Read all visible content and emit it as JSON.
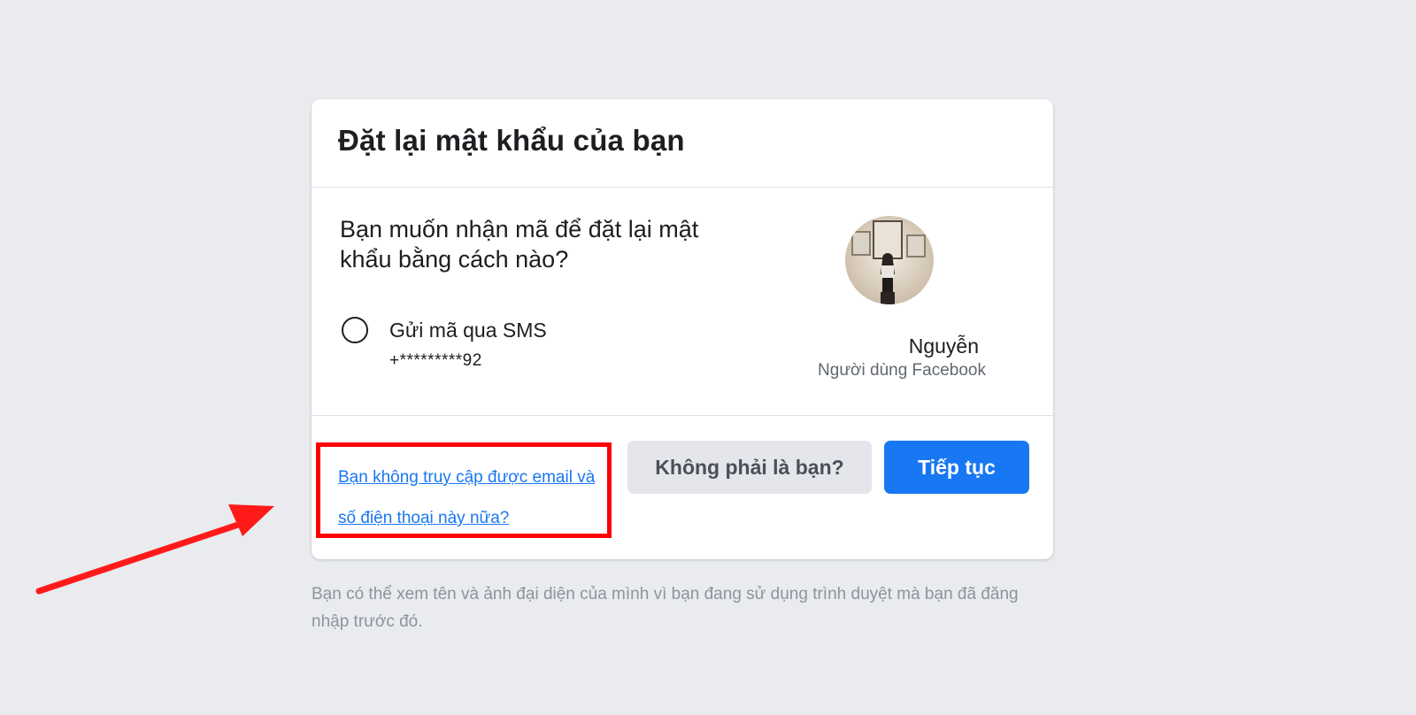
{
  "card": {
    "title": "Đặt lại mật khẩu của bạn",
    "question": "Bạn muốn nhận mã để đặt lại mật khẩu bằng cách nào?",
    "option": {
      "label": "Gửi mã qua SMS",
      "phone": "+*********92",
      "selected": false
    },
    "user": {
      "name": "Nguyễn",
      "role": "Người dùng Facebook"
    },
    "footer": {
      "help_link": "Bạn không truy cập được email và số điện thoại này nữa?",
      "not_you_label": "Không phải là bạn?",
      "continue_label": "Tiếp tục"
    }
  },
  "footnote": "Bạn có thể xem tên và ảnh đại diện của mình vì bạn đang sử dụng trình duyệt mà bạn đã đăng nhập trước đó.",
  "colors": {
    "background": "#e9ebee",
    "primary": "#1877f2",
    "secondary_button": "#e4e6eb",
    "highlight": "#ff0000",
    "muted_text": "#8d949e"
  }
}
